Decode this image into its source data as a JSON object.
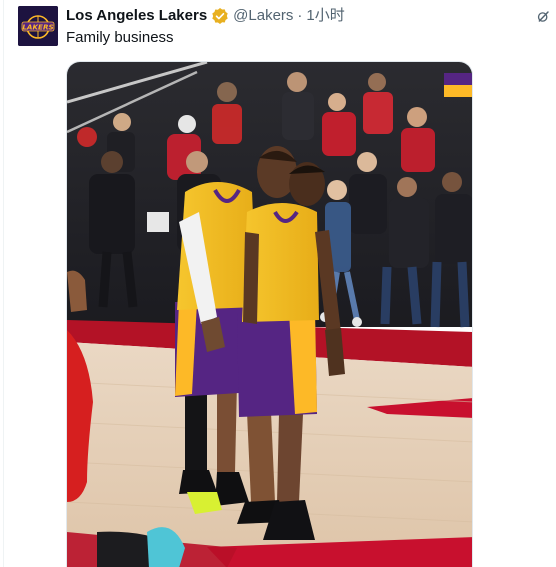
{
  "tweet": {
    "display_name": "Los Angeles Lakers",
    "handle": "@Lakers",
    "separator": "·",
    "time": "1小时",
    "text": "Family business"
  },
  "avatar": {
    "logo_text": "LAKERS"
  },
  "icons": {
    "verified": "verified-badge-icon",
    "grok": "grok-icon"
  },
  "colors": {
    "lakers_purple": "#552583",
    "lakers_gold": "#FDB927",
    "verified_gold": "#E8B020",
    "court_red": "#C8102E",
    "secondary_text": "#536471"
  }
}
